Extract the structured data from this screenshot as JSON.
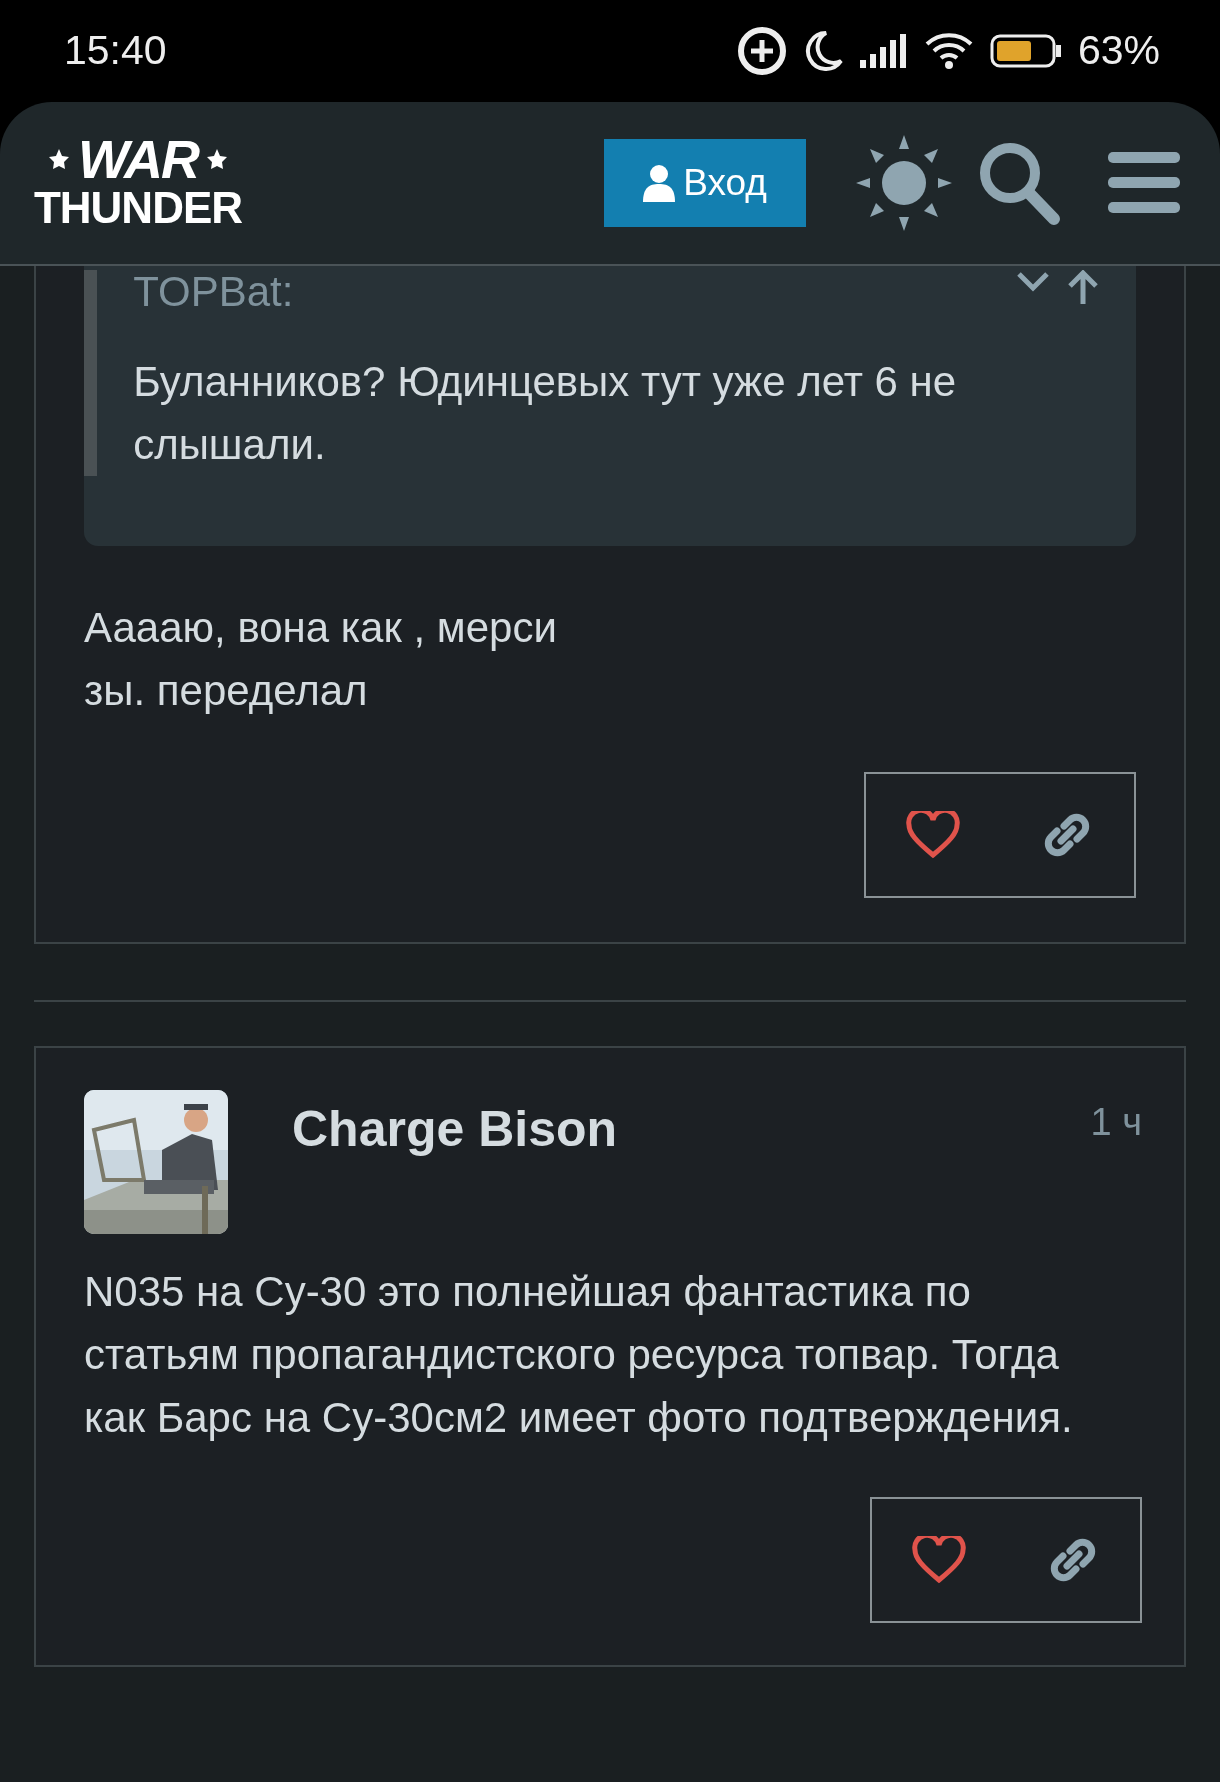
{
  "status_bar": {
    "time": "15:40",
    "battery": "63%"
  },
  "header": {
    "logo": [
      "WAR",
      "THUNDER"
    ],
    "login_button": "Вход"
  },
  "posts": [
    {
      "kind": "reply",
      "quote": {
        "author": "TOPBat:",
        "text": "Буланников? Юдинцевых тут уже лет 6 не слышали."
      },
      "body": [
        "Ааааю, вона как , мерси",
        "зы. переделал"
      ]
    },
    {
      "kind": "full",
      "author": "Charge Bison",
      "time": "1 ч",
      "avatar": {
        "kind": "picture"
      },
      "body": [
        "N035 на Су-30 это полнейшая фантастика по статьям пропагандистского ресурса топвар. Тогда как Барс на Су-30см2 имеет фото подтверждения."
      ]
    }
  ]
}
